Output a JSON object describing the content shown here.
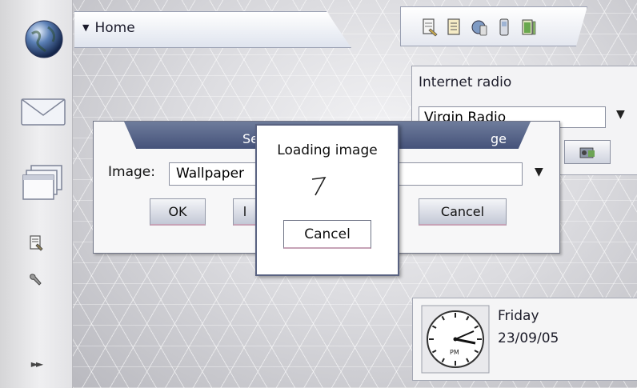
{
  "header": {
    "title": "Home"
  },
  "status_icons": [
    "document-edit-icon",
    "document-list-icon",
    "world-phone-icon",
    "phone-icon",
    "battery-icon"
  ],
  "sidebar": {
    "items": [
      "globe-icon",
      "mail-icon",
      "folders-icon",
      "settings-doc-icon",
      "wrench-icon",
      "more-arrows-icon"
    ]
  },
  "radio": {
    "title": "Internet radio",
    "station": "Virgin Radio"
  },
  "dialog": {
    "title_left": "Se",
    "title_right": "ge",
    "image_label": "Image:",
    "image_value": "Wallpaper",
    "ok_label": "OK",
    "middle_label": "l",
    "cancel_label": "Cancel"
  },
  "loading": {
    "title": "Loading image",
    "cancel_label": "Cancel"
  },
  "clock": {
    "day": "Friday",
    "date": "23/09/05",
    "period": "PM"
  },
  "colors": {
    "dialog_header": "#45527a",
    "accent_underline": "#c7a3b7"
  }
}
